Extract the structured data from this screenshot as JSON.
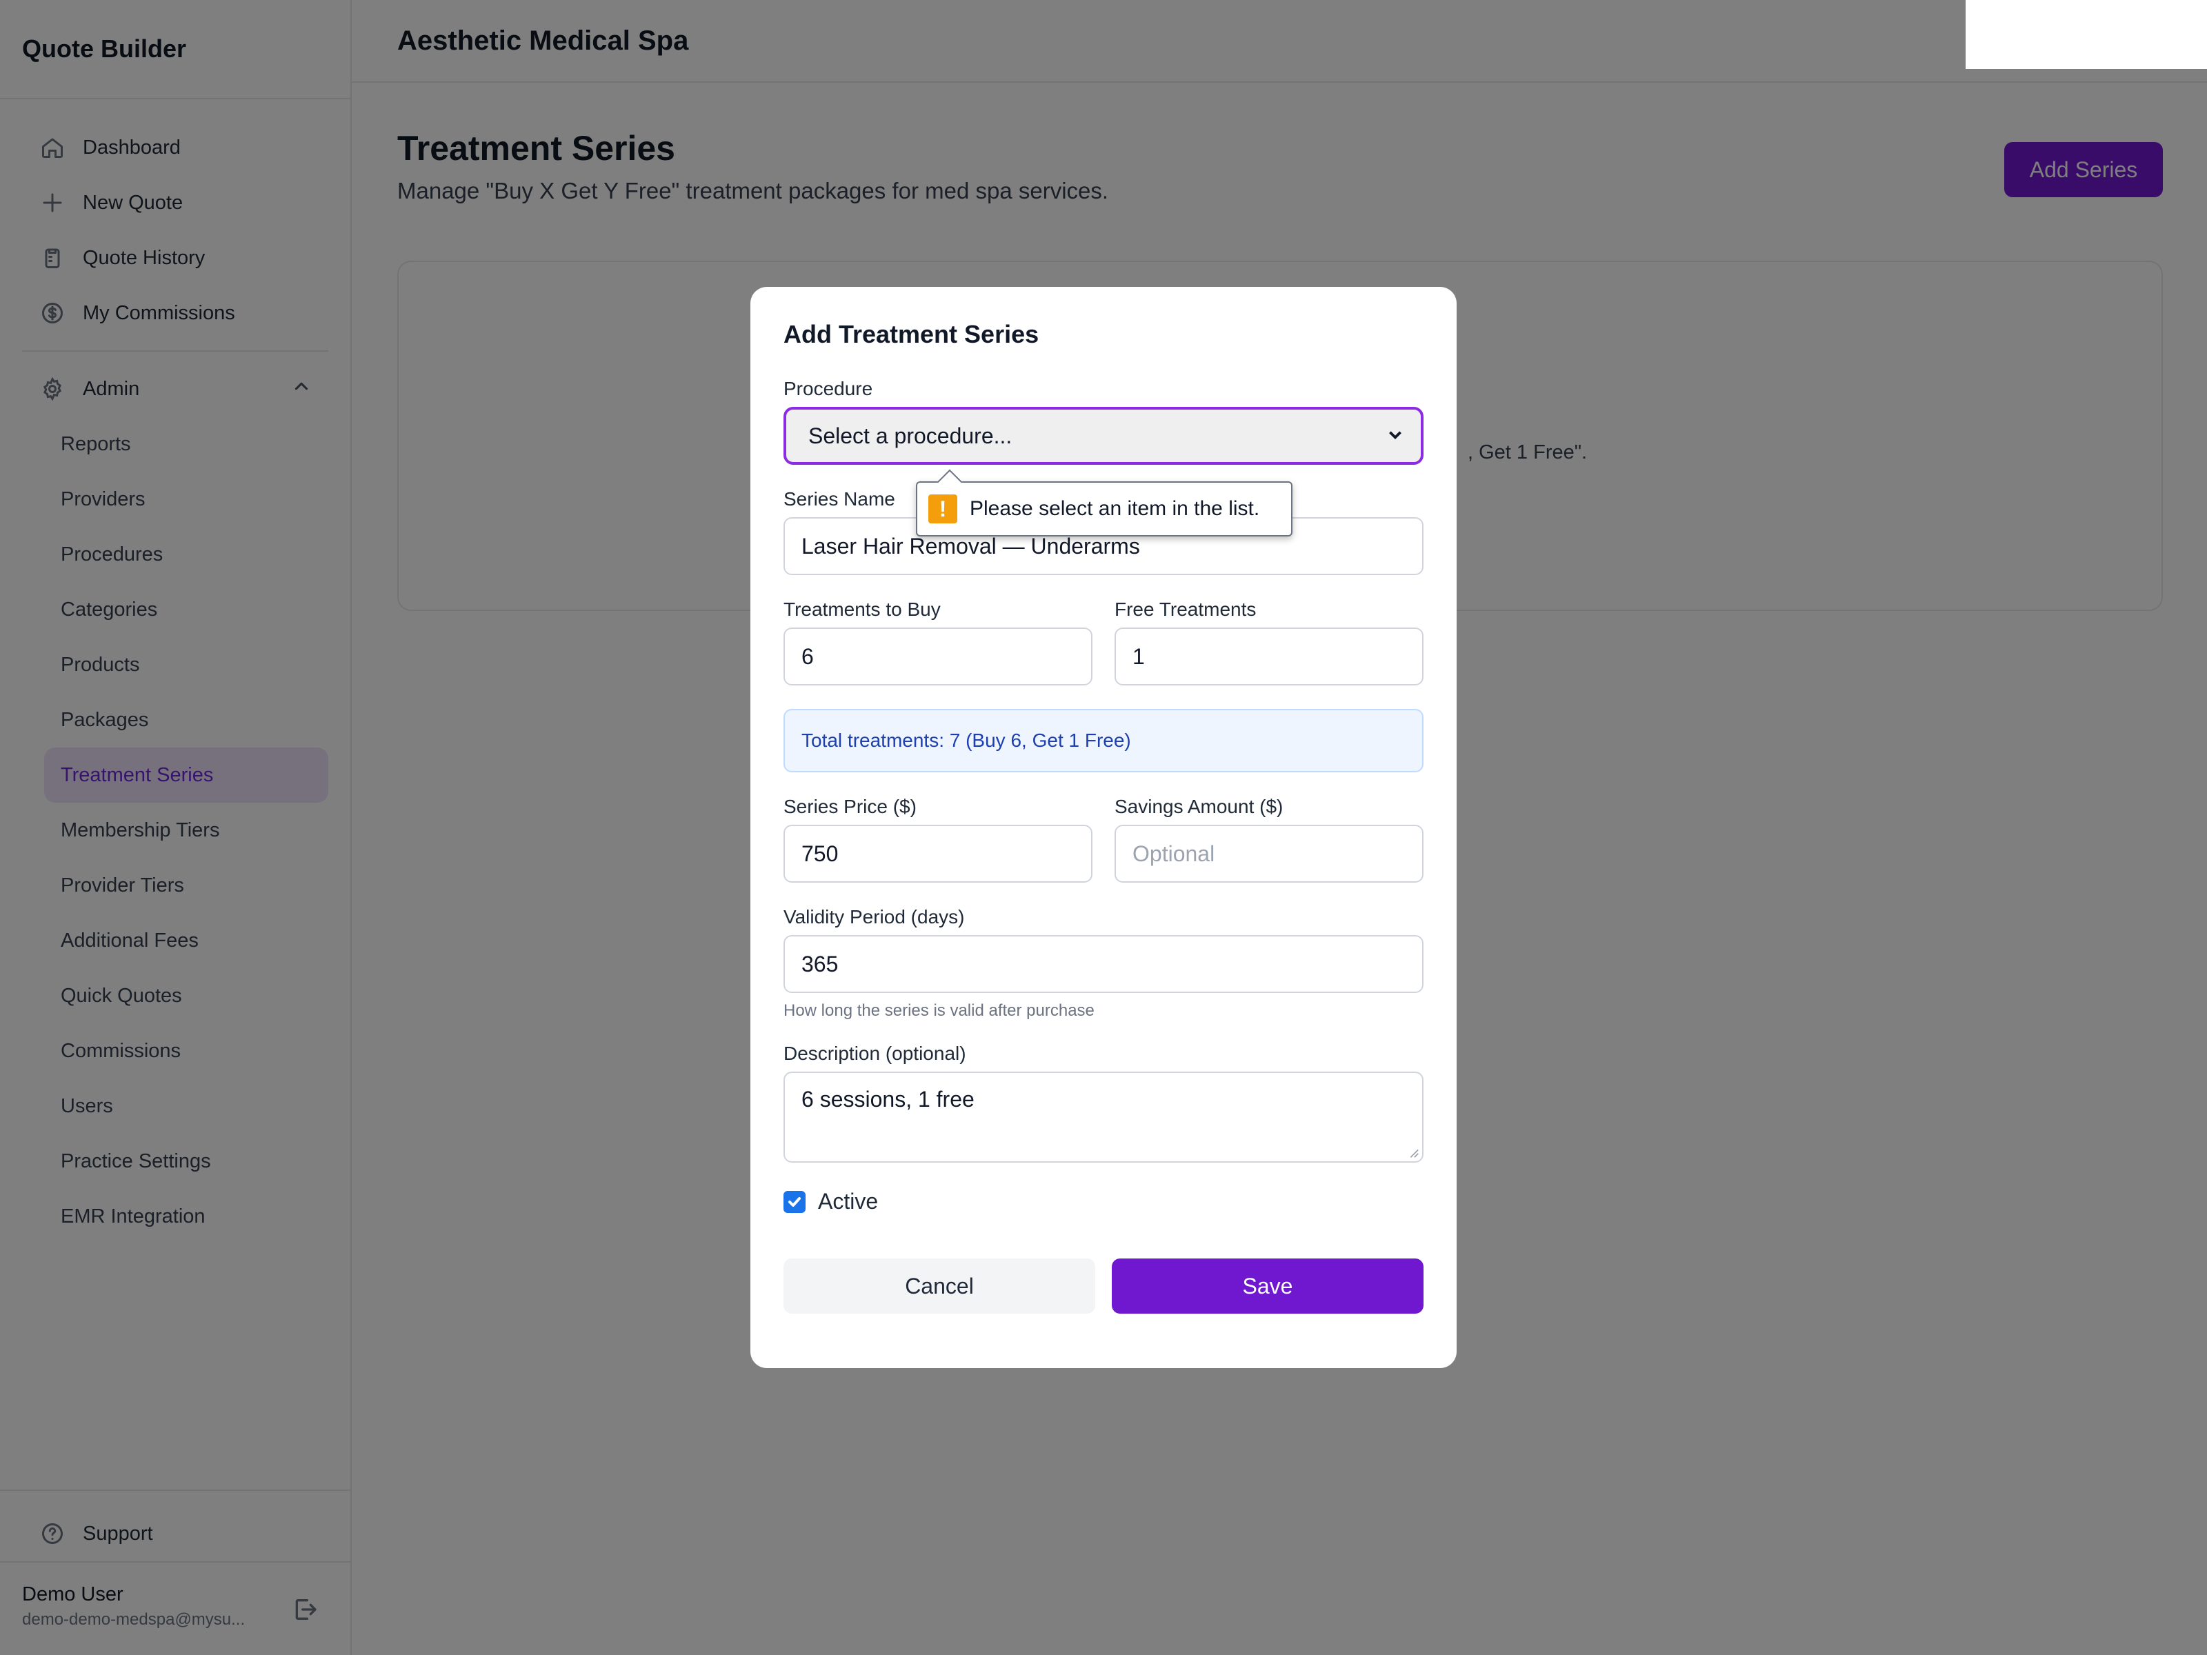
{
  "app": {
    "title": "Quote Builder",
    "practice_name": "Aesthetic Medical Spa"
  },
  "sidebar": {
    "main_items": [
      {
        "label": "Dashboard",
        "icon": "home-icon"
      },
      {
        "label": "New Quote",
        "icon": "plus-icon"
      },
      {
        "label": "Quote History",
        "icon": "clipboard-icon"
      },
      {
        "label": "My Commissions",
        "icon": "dollar-circle-icon"
      }
    ],
    "admin": {
      "label": "Admin",
      "items": [
        "Reports",
        "Providers",
        "Procedures",
        "Categories",
        "Products",
        "Packages",
        "Treatment Series",
        "Membership Tiers",
        "Provider Tiers",
        "Additional Fees",
        "Quick Quotes",
        "Commissions",
        "Users",
        "Practice Settings",
        "EMR Integration"
      ],
      "active_item": "Treatment Series"
    },
    "support_label": "Support",
    "user": {
      "name": "Demo User",
      "email": "demo-demo-medspa@mysu..."
    }
  },
  "page": {
    "title": "Treatment Series",
    "subtitle": "Manage \"Buy X Get Y Free\" treatment packages for med spa services.",
    "add_button": "Add Series",
    "empty_fragment": ", Get 1 Free\"."
  },
  "modal": {
    "title": "Add Treatment Series",
    "procedure": {
      "label": "Procedure",
      "value": "Select a procedure..."
    },
    "validation_message": "Please select an item in the list.",
    "series_name": {
      "label": "Series Name",
      "value": "Laser Hair Removal — Underarms"
    },
    "treatments_to_buy": {
      "label": "Treatments to Buy",
      "value": "6"
    },
    "free_treatments": {
      "label": "Free Treatments",
      "value": "1"
    },
    "total_info": "Total treatments: 7 (Buy 6, Get 1 Free)",
    "series_price": {
      "label": "Series Price ($)",
      "value": "750"
    },
    "savings_amount": {
      "label": "Savings Amount ($)",
      "placeholder": "Optional"
    },
    "validity": {
      "label": "Validity Period (days)",
      "value": "365",
      "hint": "How long the series is valid after purchase"
    },
    "description": {
      "label": "Description (optional)",
      "value": "6 sessions, 1 free"
    },
    "active": {
      "label": "Active",
      "checked": true
    },
    "cancel_button": "Cancel",
    "save_button": "Save"
  },
  "colors": {
    "accent": "#7018d0",
    "active_nav_bg": "#efe3fb",
    "info_bg": "#eef5ff",
    "warning": "#f59e0b"
  }
}
